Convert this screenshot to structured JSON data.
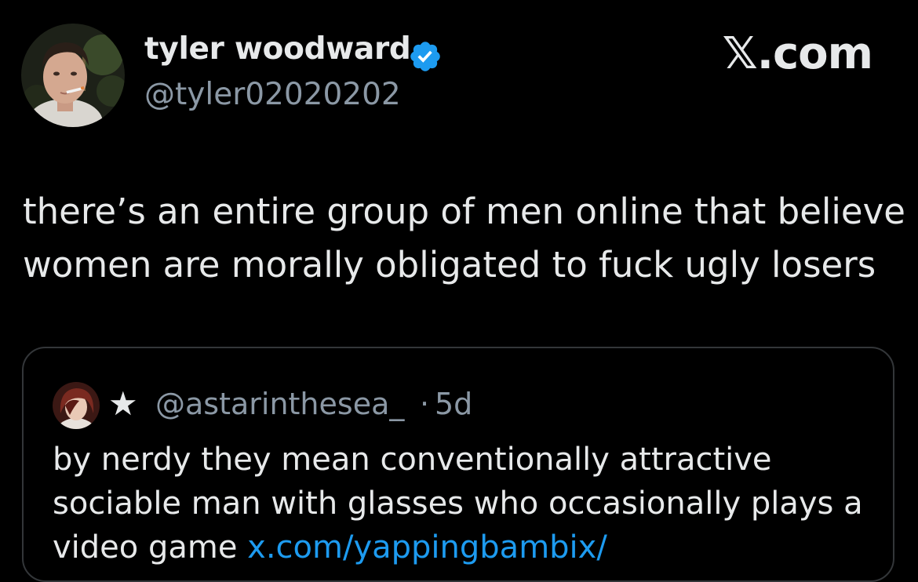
{
  "post": {
    "author_name": "tyler woodward",
    "author_handle": "@tyler02020202",
    "verified_icon": "verified-badge-icon",
    "text_lines": [
      "there’s an entire group of men online that believe",
      "women are morally obligated to fuck ugly losers"
    ]
  },
  "site_label": "𝕏.com",
  "quote": {
    "display_name": "★",
    "handle": "@astarinthesea_",
    "separator": "·",
    "time": "5d",
    "text_lines": [
      "by nerdy they mean conventionally attractive",
      "sociable man with glasses who occasionally plays a"
    ],
    "text_last_line": "video game ",
    "link": "x.com/yappingbambix/"
  },
  "colors": {
    "background": "#000000",
    "text_primary": "#e7e9ea",
    "text_secondary": "#8b98a5",
    "verified_blue": "#1d9bf0",
    "link": "#1d9bf0",
    "card_border": "#333639"
  }
}
